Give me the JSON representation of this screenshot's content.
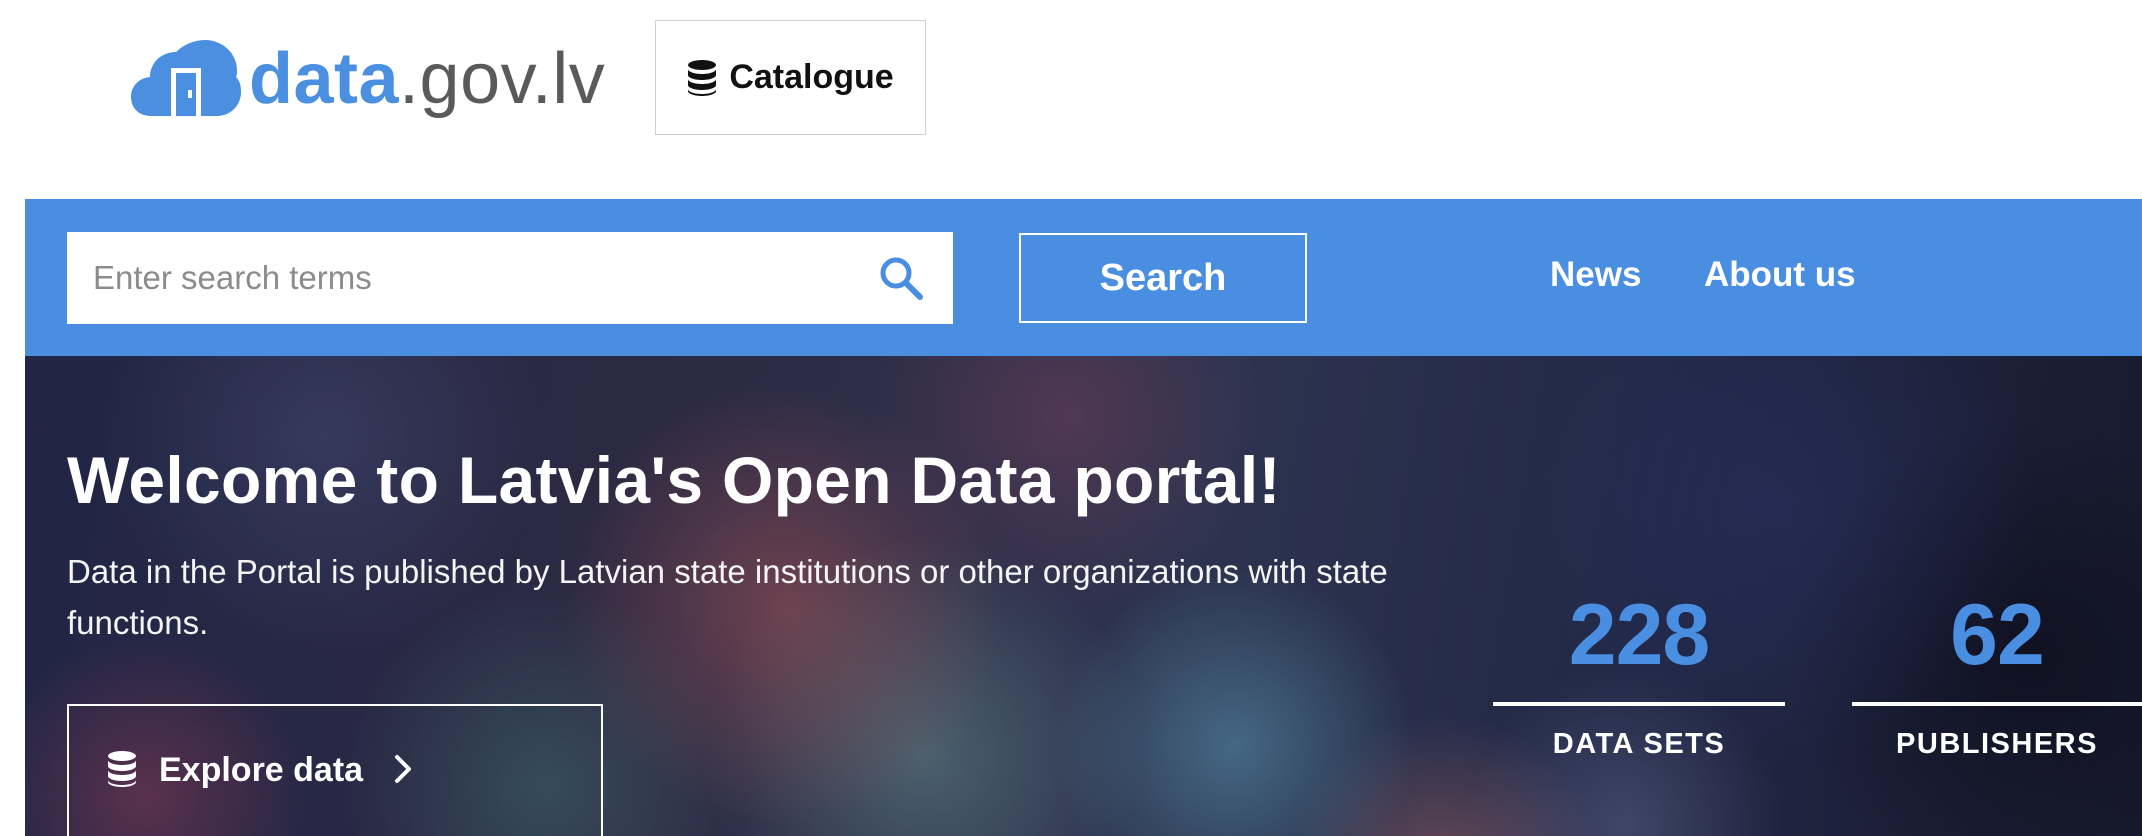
{
  "header": {
    "logo": {
      "bold": "data",
      "light": ".gov.lv"
    },
    "catalogue_label": "Catalogue"
  },
  "navbar": {
    "search": {
      "placeholder": "Enter search terms",
      "value": ""
    },
    "search_button": "Search",
    "links": [
      {
        "label": "News"
      },
      {
        "label": "About us"
      }
    ],
    "background_color": "#4a8ee2"
  },
  "hero": {
    "title": "Welcome to Latvia's Open Data portal!",
    "subtitle": "Data in the Portal is published by Latvian state institutions or other organizations with state functions.",
    "explore_button": "Explore data",
    "stats": [
      {
        "value": "228",
        "label": "DATA SETS"
      },
      {
        "value": "62",
        "label": "PUBLISHERS"
      }
    ]
  },
  "icons": {
    "logo": "cloud-door-icon",
    "catalogue": "database-icon",
    "search": "search-icon",
    "explore": "database-icon",
    "explore_chevron": "chevron-right-icon"
  },
  "colors": {
    "accent": "#4a8ee2",
    "white": "#ffffff"
  }
}
